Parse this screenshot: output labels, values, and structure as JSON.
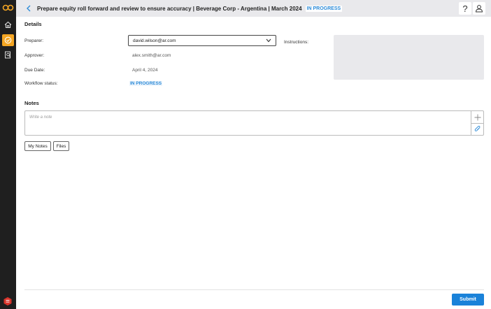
{
  "header": {
    "title": "Prepare equity roll forward and review to ensure accuracy | Beverage Corp - Argentina | March 2024",
    "status": "IN PROGRESS",
    "help_label": "?"
  },
  "sidebar": {
    "items": [
      {
        "icon": "home-icon"
      },
      {
        "icon": "task-check-icon",
        "active": true
      },
      {
        "icon": "document-search-icon"
      }
    ]
  },
  "details": {
    "heading": "Details",
    "preparer_label": "Preparer:",
    "preparer_value": "david.wilson@ar.com",
    "approver_label": "Approver:",
    "approver_value": "alex.smith@ar.com",
    "due_date_label": "Due Date:",
    "due_date_value": "April 4, 2024",
    "workflow_label": "Workflow status:",
    "workflow_value": "IN PROGRESS",
    "instructions_label": "Instructions:"
  },
  "notes": {
    "heading": "Notes",
    "placeholder": "Write a note",
    "my_notes_label": "My Notes",
    "files_label": "Files"
  },
  "footer": {
    "submit_label": "Submit"
  },
  "colors": {
    "accent": "#1a82d9",
    "status": "#2c8bd8",
    "active_nav": "#f5a623",
    "rail": "#1f1f1f"
  }
}
